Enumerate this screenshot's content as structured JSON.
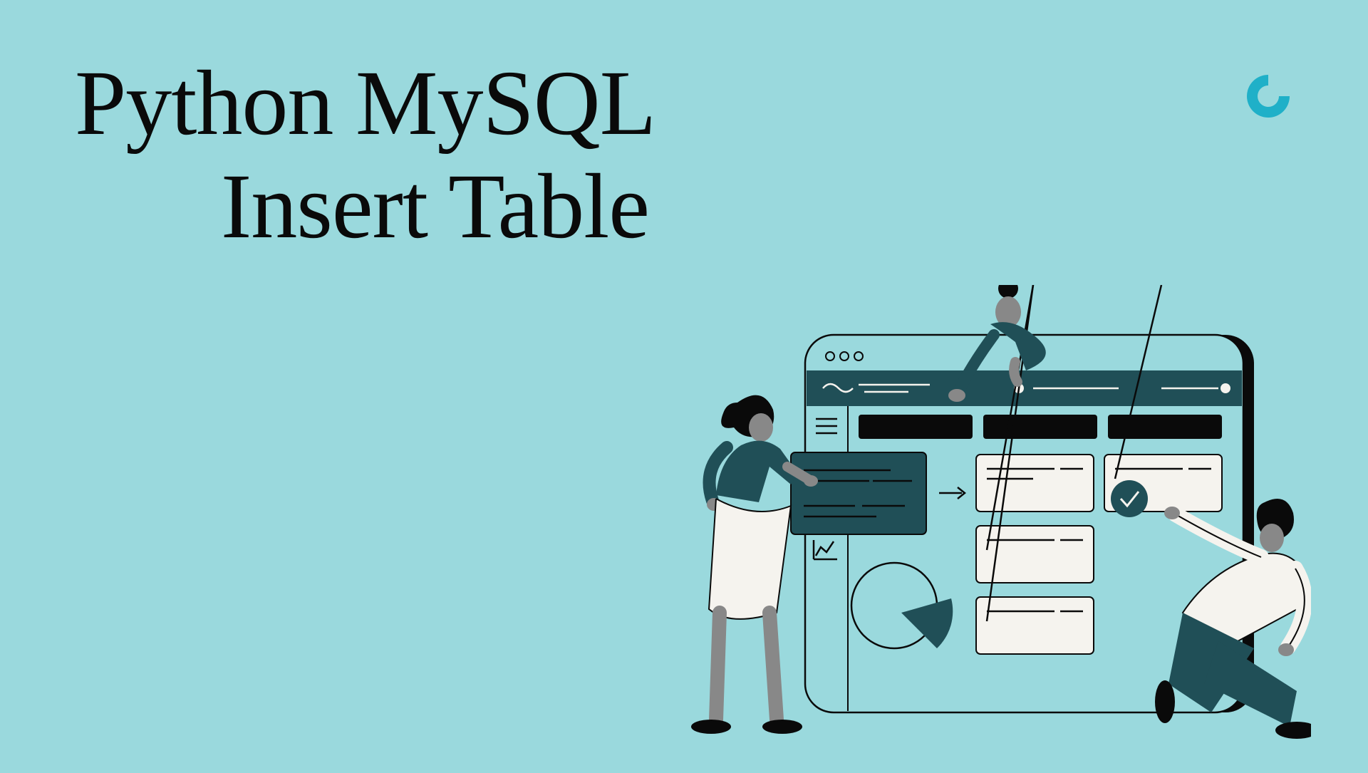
{
  "title": {
    "line1": "Python MySQL",
    "line2": "Insert Table"
  },
  "colors": {
    "background": "#9ad9dd",
    "text": "#0a0a0a",
    "accent_teal": "#204f57",
    "accent_cyan": "#1fb0c8",
    "card_fill": "#f5f3ee",
    "skin": "#888888"
  }
}
